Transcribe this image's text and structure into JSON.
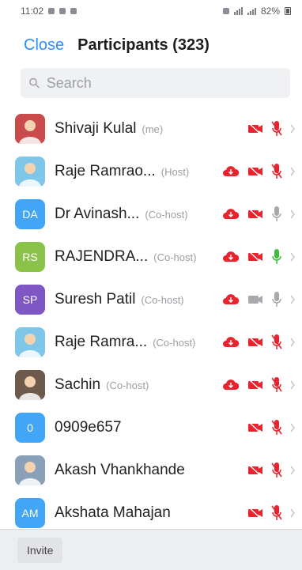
{
  "status_bar": {
    "time": "11:02",
    "battery": "82%"
  },
  "header": {
    "close_label": "Close",
    "title": "Participants (323)"
  },
  "search": {
    "placeholder": "Search"
  },
  "participants": [
    {
      "name": "Shivaji Kulal",
      "role": "(me)",
      "avatar_initials": "",
      "avatar_color": "#c94b4b",
      "cloud": false,
      "video": "off",
      "mic": "muted"
    },
    {
      "name": "Raje Ramrao...",
      "role": "(Host)",
      "avatar_initials": "",
      "avatar_color": "#7ec7e8",
      "cloud": true,
      "video": "off",
      "mic": "muted"
    },
    {
      "name": "Dr Avinash...",
      "role": "(Co-host)",
      "avatar_initials": "DA",
      "avatar_color": "#42a5f5",
      "cloud": true,
      "video": "off",
      "mic": "gray"
    },
    {
      "name": "RAJENDRA...",
      "role": "(Co-host)",
      "avatar_initials": "RS",
      "avatar_color": "#8bc34a",
      "cloud": true,
      "video": "off",
      "mic": "green"
    },
    {
      "name": "Suresh Patil",
      "role": "(Co-host)",
      "avatar_initials": "SP",
      "avatar_color": "#7e57c2",
      "cloud": true,
      "video": "gray",
      "mic": "gray"
    },
    {
      "name": "Raje Ramra...",
      "role": "(Co-host)",
      "avatar_initials": "",
      "avatar_color": "#7ec7e8",
      "cloud": true,
      "video": "off",
      "mic": "muted"
    },
    {
      "name": "Sachin",
      "role": "(Co-host)",
      "avatar_initials": "",
      "avatar_color": "#6d5a4a",
      "cloud": true,
      "video": "off",
      "mic": "muted"
    },
    {
      "name": "0909e657",
      "role": "",
      "avatar_initials": "0",
      "avatar_color": "#42a5f5",
      "cloud": false,
      "video": "off",
      "mic": "muted"
    },
    {
      "name": "Akash Vhankhande",
      "role": "",
      "avatar_initials": "",
      "avatar_color": "#8aa0b8",
      "cloud": false,
      "video": "off",
      "mic": "muted"
    },
    {
      "name": "Akshata Mahajan",
      "role": "",
      "avatar_initials": "AM",
      "avatar_color": "#42a5f5",
      "cloud": false,
      "video": "off",
      "mic": "muted"
    }
  ],
  "footer": {
    "invite_label": "Invite"
  },
  "colors": {
    "accent": "#2d8cff",
    "red": "#e8232e",
    "green": "#3dbd3d",
    "gray": "#a7a9ad"
  }
}
